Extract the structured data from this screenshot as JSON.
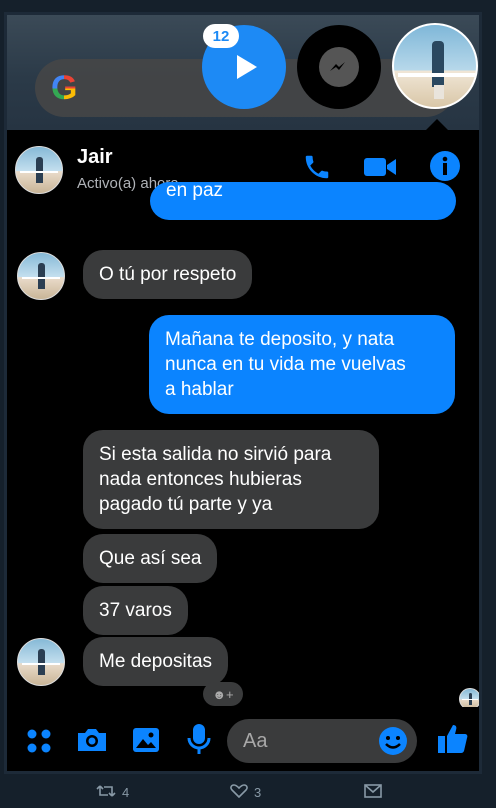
{
  "notification_badge": "12",
  "contact": {
    "name": "Jair",
    "status": "Activo(a) ahora"
  },
  "messages": {
    "partial_top": "en paz",
    "m1": "O tú por respeto",
    "m2_lines": [
      "Mañana te deposito, y nata",
      "nunca en tu vida me vuelvas",
      "a hablar"
    ],
    "m3_lines": [
      "Si esta salida no sirvió para",
      "nada entonces hubieras",
      "pagado tú parte y ya"
    ],
    "m4": "Que así sea",
    "m5": "37 varos",
    "m6": "Me depositas"
  },
  "composer": {
    "placeholder": "Aa"
  },
  "tweet": {
    "retweets": "4",
    "likes": "3"
  },
  "colors": {
    "accent": "#0b84ff",
    "incoming_bubble": "#3a3b3c",
    "background": "#000000"
  },
  "icons": [
    "google-logo",
    "play-icon",
    "messenger-icon",
    "phone-icon",
    "video-icon",
    "info-icon",
    "apps-icon",
    "camera-icon",
    "gallery-icon",
    "microphone-icon",
    "emoji-icon",
    "thumbs-up-icon",
    "retweet-icon",
    "heart-icon",
    "share-icon"
  ]
}
